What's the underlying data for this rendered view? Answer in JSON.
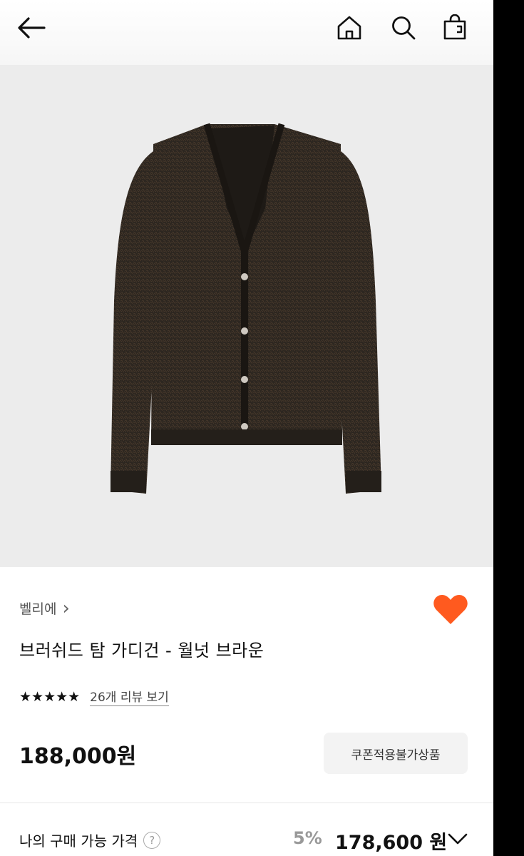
{
  "header": {
    "back_icon": "arrow-left-icon",
    "home_icon": "home-icon",
    "search_icon": "search-icon",
    "bag_icon": "shopping-bag-icon"
  },
  "product": {
    "image": "dark brown fuzzy v-neck cardigan with buttons",
    "brand": "벨리에",
    "brand_chevron": "›",
    "title": "브러쉬드 탐 가디건 - 월넛 브라운",
    "liked": true,
    "like_color": "#FF5A1F",
    "rating_stars": 5,
    "stars_text": "★★★★★",
    "reviews_link": "26개 리뷰 보기",
    "price": "188,000원",
    "coupon_badge": "쿠폰적용불가상품"
  },
  "purchase": {
    "label": "나의 구매 가능 가격",
    "help_icon": "?",
    "discount": "5%",
    "final_price": "178,600 원"
  }
}
